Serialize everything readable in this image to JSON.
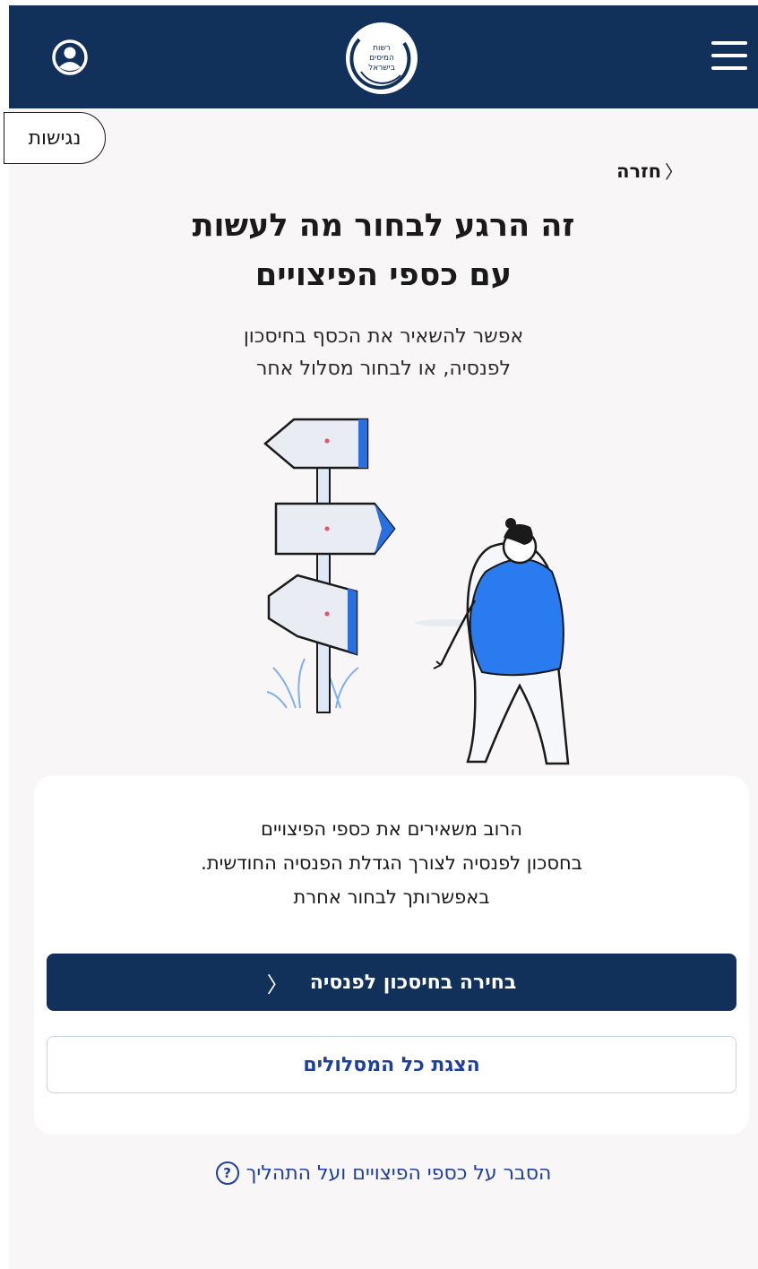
{
  "header": {
    "logo_text": [
      "רשות",
      "המיסים",
      "בישראל"
    ],
    "menu_icon": "hamburger-icon",
    "user_icon": "user-circle-icon"
  },
  "accessibility": {
    "label": "נגישות"
  },
  "nav": {
    "back_label": "חזרה",
    "back_icon": "chevron-right-icon"
  },
  "main": {
    "title_line1": "זה הרגע לבחור מה לעשות",
    "title_line2": "עם כספי הפיצויים",
    "subtitle_line1": "אפשר להשאיר את הכסף בחיסכון",
    "subtitle_line2": "לפנסיה, או לבחור מסלול אחר"
  },
  "card": {
    "text_line1": "הרוב משאירים את כספי הפיצויים",
    "text_line2": "בחסכון לפנסיה לצורך הגדלת הפנסיה החודשית.",
    "text_line3": "באפשרותך לבחור אחרת",
    "primary_label": "בחירה בחיסכון לפנסיה",
    "secondary_label": "הצגת כל המסלולים"
  },
  "footer": {
    "explain_label": "הסבר על כספי הפיצויים ועל התהליך",
    "help_icon": "question-circle-icon"
  },
  "colors": {
    "navy": "#11305a",
    "link_blue": "#1d3fa0",
    "accent_blue": "#2a6fe0",
    "page_bg": "#f8f6f7"
  }
}
